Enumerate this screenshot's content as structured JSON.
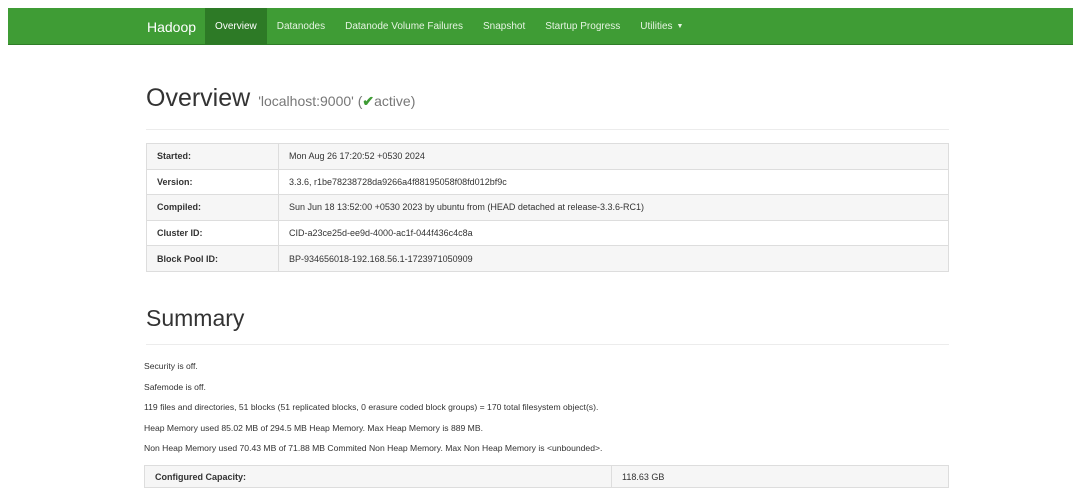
{
  "navbar": {
    "brand": "Hadoop",
    "items": [
      {
        "label": "Overview",
        "active": true
      },
      {
        "label": "Datanodes"
      },
      {
        "label": "Datanode Volume Failures"
      },
      {
        "label": "Snapshot"
      },
      {
        "label": "Startup Progress"
      },
      {
        "label": "Utilities"
      }
    ],
    "bg_color": "#3f9c35"
  },
  "overview": {
    "title": "Overview",
    "host": "'localhost:9000'",
    "status_open": "(",
    "status_check": "✔",
    "status_word": "active",
    "status_close": ")"
  },
  "info_table": [
    {
      "key": "Started:",
      "value": "Mon Aug 26 17:20:52 +0530 2024"
    },
    {
      "key": "Version:",
      "value": "3.3.6, r1be78238728da9266a4f88195058f08fd012bf9c"
    },
    {
      "key": "Compiled:",
      "value": "Sun Jun 18 13:52:00 +0530 2023 by ubuntu from (HEAD detached at release-3.3.6-RC1)"
    },
    {
      "key": "Cluster ID:",
      "value": "CID-a23ce25d-ee9d-4000-ac1f-044f436c4c8a"
    },
    {
      "key": "Block Pool ID:",
      "value": "BP-934656018-192.168.56.1-1723971050909"
    }
  ],
  "summary": {
    "title": "Summary",
    "lines": [
      "Security is off.",
      "Safemode is off.",
      "119 files and directories, 51 blocks (51 replicated blocks, 0 erasure coded block groups) = 170 total filesystem object(s).",
      "Heap Memory used 85.02 MB of 294.5 MB Heap Memory. Max Heap Memory is 889 MB.",
      "Non Heap Memory used 70.43 MB of 71.88 MB Commited Non Heap Memory. Max Non Heap Memory is <unbounded>."
    ],
    "capacity_label": "Configured Capacity:",
    "capacity_value": "118.63 GB"
  }
}
